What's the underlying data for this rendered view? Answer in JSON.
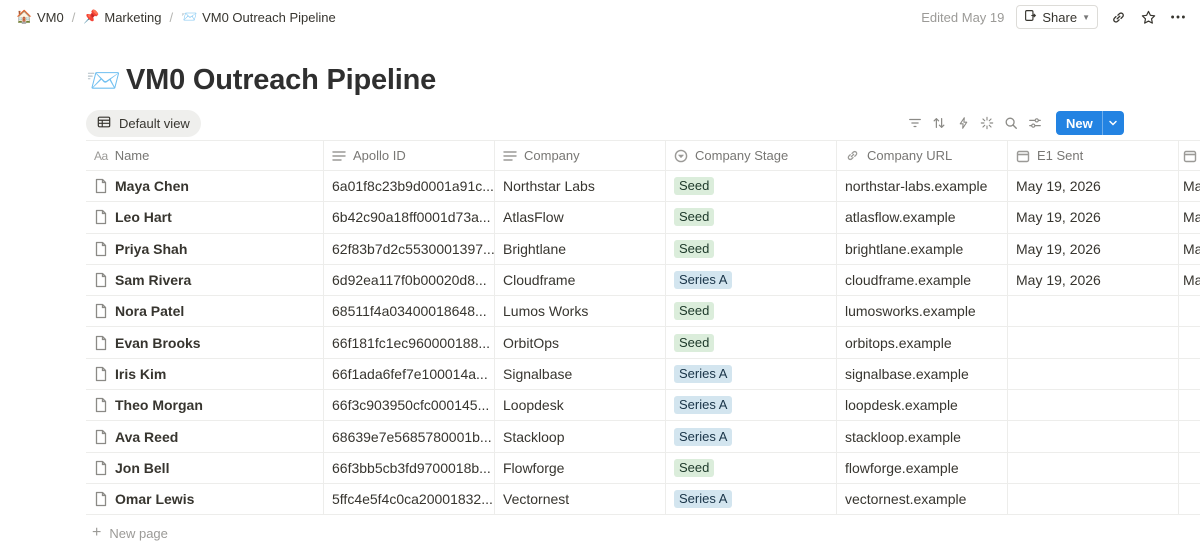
{
  "breadcrumb": [
    {
      "icon": "house-icon",
      "emoji": "🏠",
      "label": "VM0"
    },
    {
      "icon": "pushpin-icon",
      "emoji": "📌",
      "label": "Marketing"
    },
    {
      "icon": "envelope-icon",
      "emoji": "📨",
      "label": "VM0 Outreach Pipeline"
    }
  ],
  "topbar": {
    "edited": "Edited May 19",
    "share_label": "Share"
  },
  "page": {
    "title_emoji": "📨",
    "title": "VM0 Outreach Pipeline"
  },
  "view": {
    "label": "Default view",
    "new_label": "New"
  },
  "colors": {
    "accent": "#2383e2",
    "seed_bg": "#dbeddb",
    "series_bg": "#d3e5ef"
  },
  "columns": [
    "Name",
    "Apollo ID",
    "Company",
    "Company Stage",
    "Company URL",
    "E1 Sent"
  ],
  "rows": [
    {
      "name": "Maya Chen",
      "apollo": "6a01f8c23b9d0001a91c...",
      "company": "Northstar Labs",
      "stage": "Seed",
      "url": "northstar-labs.example",
      "e1": "May 19, 2026",
      "extra": "Ma"
    },
    {
      "name": "Leo Hart",
      "apollo": "6b42c90a18ff0001d73a...",
      "company": "AtlasFlow",
      "stage": "Seed",
      "url": "atlasflow.example",
      "e1": "May 19, 2026",
      "extra": "Ma"
    },
    {
      "name": "Priya Shah",
      "apollo": "62f83b7d2c5530001397...",
      "company": "Brightlane",
      "stage": "Seed",
      "url": "brightlane.example",
      "e1": "May 19, 2026",
      "extra": "Ma"
    },
    {
      "name": "Sam Rivera",
      "apollo": "6d92ea117f0b00020d8...",
      "company": "Cloudframe",
      "stage": "Series A",
      "url": "cloudframe.example",
      "e1": "May 19, 2026",
      "extra": "Ma"
    },
    {
      "name": "Nora Patel",
      "apollo": "68511f4a03400018648...",
      "company": "Lumos Works",
      "stage": "Seed",
      "url": "lumosworks.example",
      "e1": "",
      "extra": ""
    },
    {
      "name": "Evan Brooks",
      "apollo": "66f181fc1ec960000188...",
      "company": "OrbitOps",
      "stage": "Seed",
      "url": "orbitops.example",
      "e1": "",
      "extra": ""
    },
    {
      "name": "Iris Kim",
      "apollo": "66f1ada6fef7e100014a...",
      "company": "Signalbase",
      "stage": "Series A",
      "url": "signalbase.example",
      "e1": "",
      "extra": ""
    },
    {
      "name": "Theo Morgan",
      "apollo": "66f3c903950cfc000145...",
      "company": "Loopdesk",
      "stage": "Series A",
      "url": "loopdesk.example",
      "e1": "",
      "extra": ""
    },
    {
      "name": "Ava Reed",
      "apollo": "68639e7e5685780001b...",
      "company": "Stackloop",
      "stage": "Series A",
      "url": "stackloop.example",
      "e1": "",
      "extra": ""
    },
    {
      "name": "Jon Bell",
      "apollo": "66f3bb5cb3fd9700018b...",
      "company": "Flowforge",
      "stage": "Seed",
      "url": "flowforge.example",
      "e1": "",
      "extra": ""
    },
    {
      "name": "Omar Lewis",
      "apollo": "5ffc4e5f4c0ca20001832...",
      "company": "Vectornest",
      "stage": "Series A",
      "url": "vectornest.example",
      "e1": "",
      "extra": ""
    }
  ],
  "footer": {
    "new_page": "New page"
  }
}
